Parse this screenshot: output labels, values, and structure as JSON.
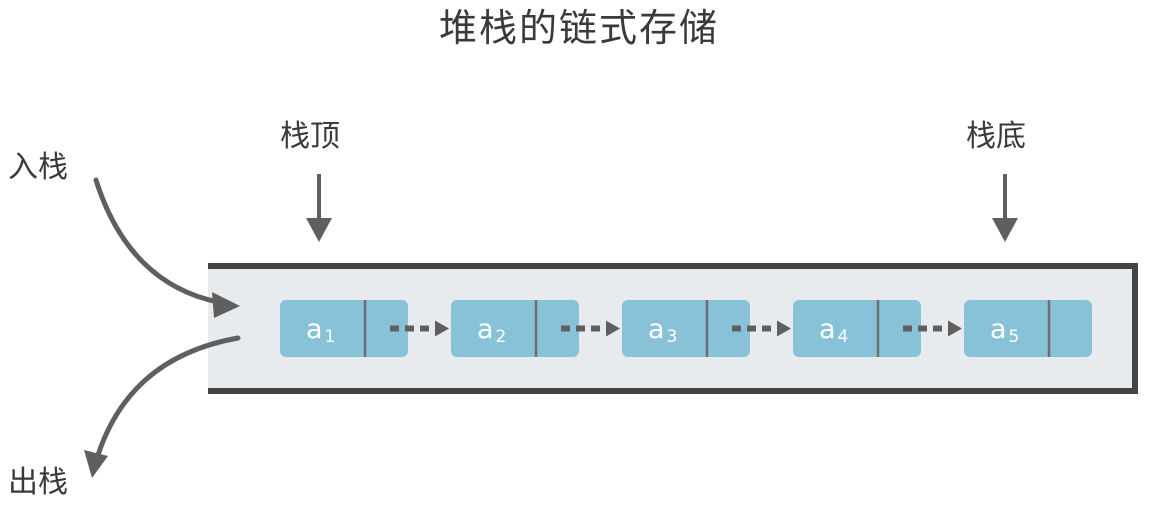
{
  "title": "堆栈的链式存储",
  "labels": {
    "stack_top": "栈顶",
    "stack_bottom": "栈底",
    "push": "入栈",
    "pop": "出栈"
  },
  "nodes": [
    {
      "letter": "a",
      "index": "1"
    },
    {
      "letter": "a",
      "index": "2"
    },
    {
      "letter": "a",
      "index": "3"
    },
    {
      "letter": "a",
      "index": "4"
    },
    {
      "letter": "a",
      "index": "5"
    }
  ],
  "colors": {
    "node_fill": "#88c2d9",
    "node_border": "#6f6f6f",
    "container_fill": "#e8ebed",
    "container_border": "#444444",
    "arrow": "#5f5f5f",
    "text": "#3a3a3a"
  }
}
